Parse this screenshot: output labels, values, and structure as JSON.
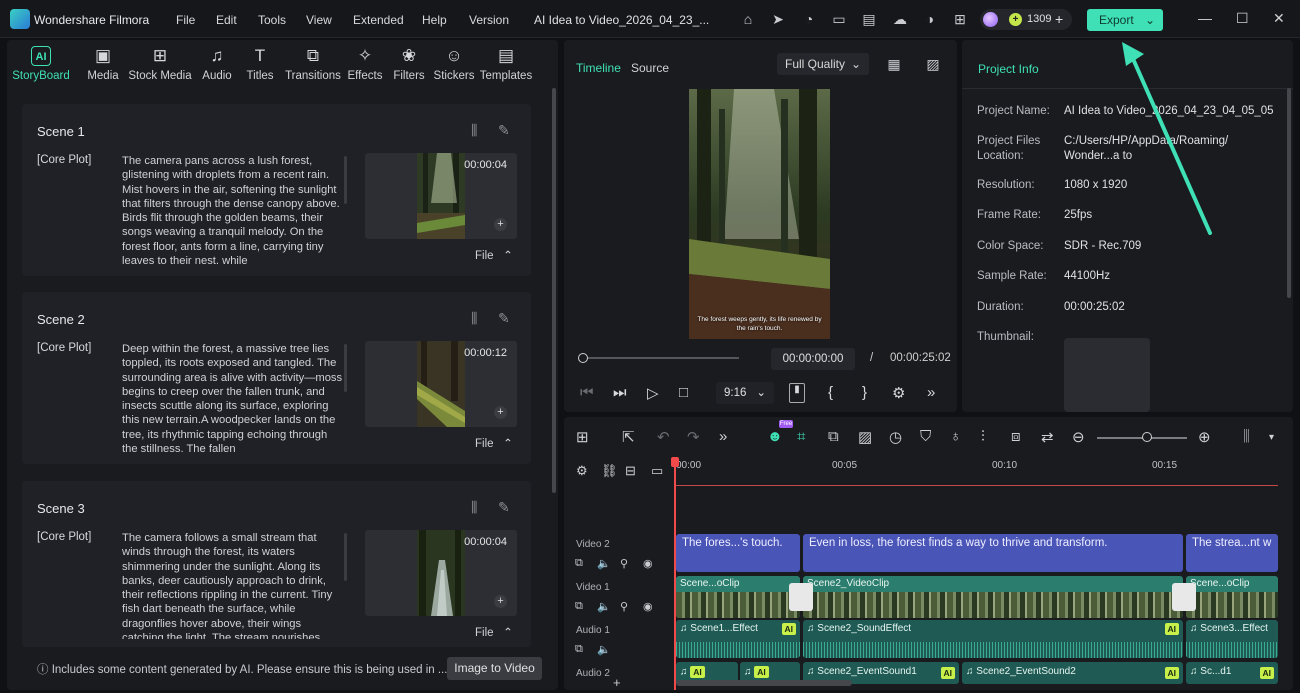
{
  "app": {
    "name": "Wondershare Filmora",
    "project_title": "AI Idea to Video_2026_04_23_..."
  },
  "menu": [
    "File",
    "Edit",
    "Tools",
    "View",
    "Extended",
    "Help",
    "Version"
  ],
  "credits": {
    "count": "1309"
  },
  "export_label": "Export",
  "tabs": [
    {
      "label": "StoryBoard",
      "icon": "AI"
    },
    {
      "label": "Media",
      "icon": "▣"
    },
    {
      "label": "Stock Media",
      "icon": "⊞"
    },
    {
      "label": "Audio",
      "icon": "♫"
    },
    {
      "label": "Titles",
      "icon": "T"
    },
    {
      "label": "Transitions",
      "icon": "⧉"
    },
    {
      "label": "Effects",
      "icon": "✧"
    },
    {
      "label": "Filters",
      "icon": "❀"
    },
    {
      "label": "Stickers",
      "icon": "☺"
    },
    {
      "label": "Templates",
      "icon": "▤"
    }
  ],
  "scenes": [
    {
      "title": "Scene 1",
      "tag": "[Core Plot]",
      "duration": "00:00:04",
      "file": "File",
      "text": "The camera pans across a lush forest, glistening with droplets from a recent rain. Mist hovers in the air, softening the sunlight that filters through the dense canopy above. Birds flit through the golden beams, their songs weaving a tranquil melody. On the forest floor, ants form a line, carrying tiny leaves to their nest, while"
    },
    {
      "title": "Scene 2",
      "tag": "[Core Plot]",
      "duration": "00:00:12",
      "file": "File",
      "text": "Deep within the forest, a massive tree lies toppled, its roots exposed and tangled. The surrounding area is alive with activity—moss begins to creep over the fallen trunk, and insects scuttle along its surface, exploring this new terrain.A woodpecker lands on the tree, its rhythmic tapping echoing through the stillness. The fallen"
    },
    {
      "title": "Scene 3",
      "tag": "[Core Plot]",
      "duration": "00:00:04",
      "file": "File",
      "text": "The camera follows a small stream that winds through the forest, its waters shimmering under the sunlight. Along its banks, deer cautiously approach to drink, their reflections rippling in the current. Tiny fish dart beneath the surface, while dragonflies hover above, their wings catching the light. The stream nourishes"
    }
  ],
  "disclaimer": "Includes some content generated by AI. Please ensure this is being used in ...",
  "image_to_video": "Image to Video",
  "preview": {
    "tabs": [
      "Timeline",
      "Source"
    ],
    "quality": "Full Quality",
    "caption": "The forest weeps gently, its life renewed by the rain's touch.",
    "time_current": "00:00:00:00",
    "time_sep": "/",
    "time_total": "00:00:25:02",
    "ratio": "9:16"
  },
  "project_info": {
    "header": "Project Info",
    "rows": [
      {
        "label": "Project Name:",
        "value": "AI Idea to Video_2026_04_23_04_05_05"
      },
      {
        "label": "Project Files Location:",
        "value": "C:/Users/HP/AppData/Roaming/ Wonder...a to"
      },
      {
        "label": "Resolution:",
        "value": "1080 x 1920"
      },
      {
        "label": "Frame Rate:",
        "value": "25fps"
      },
      {
        "label": "Color Space:",
        "value": "SDR - Rec.709"
      },
      {
        "label": "Sample Rate:",
        "value": "44100Hz"
      },
      {
        "label": "Duration:",
        "value": "00:00:25:02"
      },
      {
        "label": "Thumbnail:",
        "value": ""
      }
    ]
  },
  "timeline": {
    "free_badge": "Free",
    "ruler": [
      "00:00",
      "00:05",
      "00:10",
      "00:15"
    ],
    "tracks": {
      "video2": "Video 2",
      "video1": "Video 1",
      "audio1": "Audio 1",
      "audio2": "Audio 2"
    },
    "title_clips": [
      "The fores...'s touch.",
      "Even in loss, the forest finds a way to thrive and transform.",
      "The strea...nt w"
    ],
    "video_clips": [
      "Scene...oClip",
      "Scene2_VideoClip",
      "Scene...oClip"
    ],
    "audio1_clips": [
      "Scene1...Effect",
      "Scene2_SoundEffect",
      "Scene3...Effect"
    ],
    "audio2_clips": [
      "Scene2_EventSound1",
      "Scene2_EventSound2",
      "Sc...d1"
    ],
    "ai_badge": "AI"
  },
  "colors": {
    "accent": "#3fe0b5",
    "title_clip": "#4a55b8",
    "video_clip": "#2b7d6d",
    "audio_clip": "#1f5b54",
    "playhead": "#f04a4a"
  }
}
